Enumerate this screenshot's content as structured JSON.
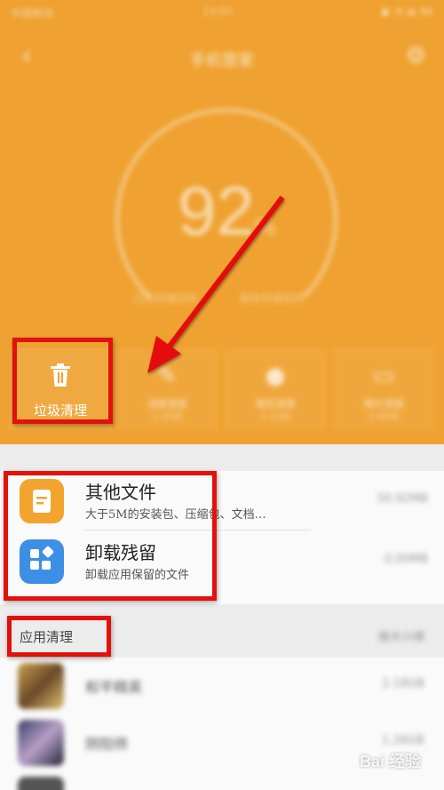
{
  "colors": {
    "header_bg": "#efa231",
    "accent_red": "#e3110b",
    "other_files_icon": "#f2a42e",
    "residue_icon": "#3d8fe6"
  },
  "status_bar": {
    "carrier": "中国移动",
    "time": "13:07",
    "battery": "86"
  },
  "topbar": {
    "back_icon": "chevron-left-icon",
    "title": "手机管家",
    "settings_icon": "gear-icon"
  },
  "gauge": {
    "value": "92",
    "unit": "%",
    "caption_left": "已用存储空间",
    "caption_right": "剩余存储空间"
  },
  "tabs": [
    {
      "label": "垃圾清理",
      "sub": "",
      "icon": "trash-icon"
    },
    {
      "label": "深度清理",
      "sub": "1.2GB",
      "icon": "broom-icon"
    },
    {
      "label": "微信清理",
      "sub": "1.1GB",
      "icon": "bottle-icon"
    },
    {
      "label": "照片清理",
      "sub": "2.6GB",
      "icon": "photo-icon"
    }
  ],
  "rows": [
    {
      "title": "其他文件",
      "desc": "大于5M的安装包、压缩包、文档…",
      "size": "50.92MB"
    },
    {
      "title": "卸载残留",
      "desc": "卸载应用保留的文件",
      "size": "0.00MB"
    }
  ],
  "apps_section": {
    "title": "应用清理",
    "action": "按大小排"
  },
  "apps": [
    {
      "name": "和平精英",
      "size": "2.18GB"
    },
    {
      "name": "阴阳师",
      "size": "1.26GB"
    }
  ],
  "watermark": "Bai 经验"
}
